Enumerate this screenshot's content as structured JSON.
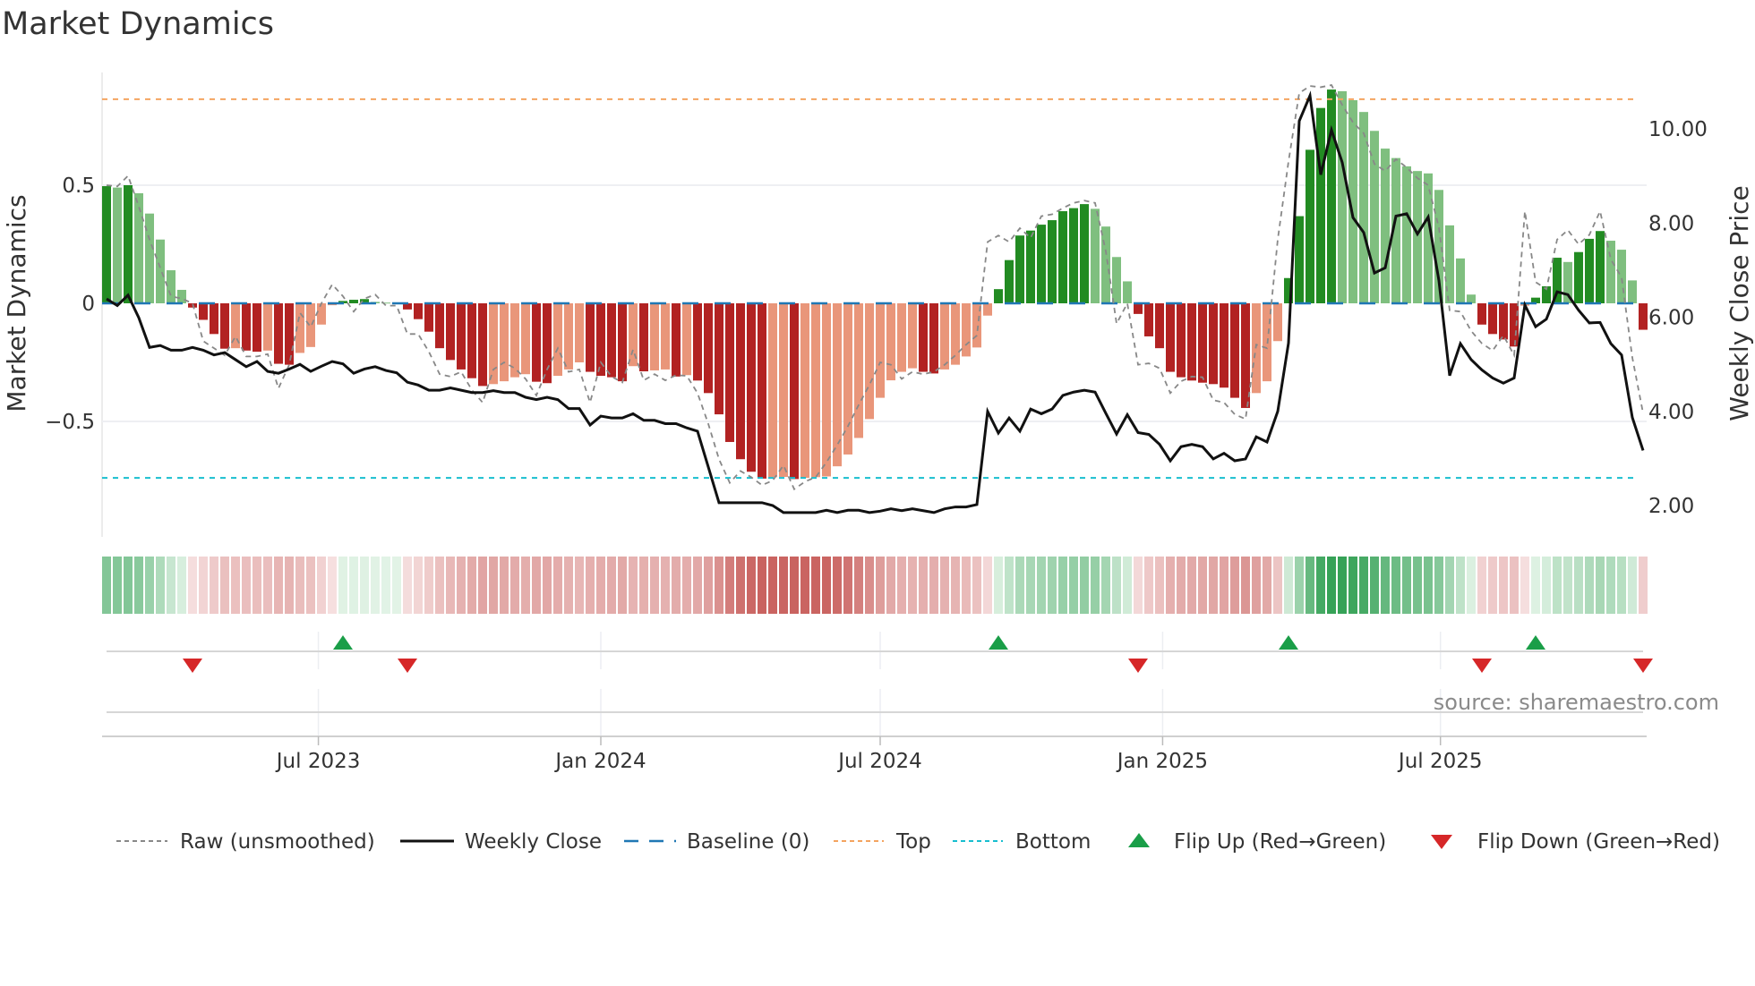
{
  "title": "Market Dynamics",
  "source": "source: sharemaestro.com",
  "colors": {
    "rising_positive": "#228b22",
    "falling_positive": "#7fbf7f",
    "falling_negative": "#b22222",
    "rising_negative": "#e9967a",
    "raw": "#888888",
    "close": "#111111",
    "baseline": "#1f77b4",
    "top": "#f4a460",
    "bottom": "#17becf",
    "flip_up": "#1a9e48",
    "flip_down": "#d62728"
  },
  "legend": {
    "raw": "Raw (unsmoothed)",
    "close": "Weekly Close",
    "baseline": "Baseline (0)",
    "top": "Top",
    "bottom": "Bottom",
    "flip_up": "Flip Up (Red→Green)",
    "flip_down": "Flip Down (Green→Red)"
  },
  "chart_data": {
    "type": "bar",
    "title": "Market Dynamics",
    "ylabel": "Market Dynamics",
    "y2label": "Weekly Close Price",
    "ylim": [
      -0.98,
      0.98
    ],
    "y2lim": [
      1.2,
      11.4
    ],
    "yticks": [
      {
        "v": 0.5,
        "label": "0.5"
      },
      {
        "v": 0,
        "label": "0"
      },
      {
        "v": -0.5,
        "label": "−0.5"
      }
    ],
    "y2ticks": [
      {
        "v": 10,
        "label": "10.00"
      },
      {
        "v": 8,
        "label": "8.00"
      },
      {
        "v": 6,
        "label": "6.00"
      },
      {
        "v": 4,
        "label": "4.00"
      },
      {
        "v": 2,
        "label": "2.00"
      }
    ],
    "xticks": [
      {
        "date": "2023-07-01",
        "label": "Jul 2023"
      },
      {
        "date": "2024-01-01",
        "label": "Jan 2024"
      },
      {
        "date": "2024-07-01",
        "label": "Jul 2024"
      },
      {
        "date": "2025-01-01",
        "label": "Jan 2025"
      },
      {
        "date": "2025-07-01",
        "label": "Jul 2025"
      }
    ],
    "start_date": "2023-02-13",
    "frequency": "weekly",
    "top_level": 0.864,
    "bottom_level": -0.739,
    "baseline": 0,
    "dynamics": [
      0.496,
      0.49,
      0.5,
      0.466,
      0.38,
      0.27,
      0.14,
      0.057,
      -0.018,
      -0.07,
      -0.13,
      -0.192,
      -0.19,
      -0.2,
      -0.205,
      -0.2,
      -0.256,
      -0.26,
      -0.21,
      -0.185,
      -0.09,
      -0.008,
      0.01,
      0.015,
      0.018,
      0.006,
      0.003,
      0.002,
      -0.026,
      -0.067,
      -0.12,
      -0.19,
      -0.24,
      -0.28,
      -0.317,
      -0.35,
      -0.342,
      -0.33,
      -0.313,
      -0.3,
      -0.332,
      -0.338,
      -0.307,
      -0.28,
      -0.25,
      -0.29,
      -0.307,
      -0.313,
      -0.33,
      -0.266,
      -0.288,
      -0.284,
      -0.28,
      -0.31,
      -0.304,
      -0.327,
      -0.38,
      -0.47,
      -0.587,
      -0.66,
      -0.713,
      -0.742,
      -0.736,
      -0.735,
      -0.744,
      -0.739,
      -0.736,
      -0.733,
      -0.69,
      -0.64,
      -0.57,
      -0.49,
      -0.4,
      -0.326,
      -0.29,
      -0.275,
      -0.29,
      -0.297,
      -0.28,
      -0.26,
      -0.225,
      -0.187,
      -0.052,
      0.06,
      0.183,
      0.287,
      0.308,
      0.333,
      0.352,
      0.39,
      0.403,
      0.42,
      0.4,
      0.325,
      0.196,
      0.093,
      -0.045,
      -0.14,
      -0.19,
      -0.29,
      -0.313,
      -0.327,
      -0.336,
      -0.342,
      -0.357,
      -0.4,
      -0.443,
      -0.38,
      -0.33,
      -0.16,
      0.107,
      0.369,
      0.65,
      0.827,
      0.905,
      0.898,
      0.86,
      0.81,
      0.73,
      0.655,
      0.615,
      0.58,
      0.56,
      0.55,
      0.48,
      0.33,
      0.19,
      0.037,
      -0.09,
      -0.13,
      -0.153,
      -0.183,
      -0.01,
      0.024,
      0.072,
      0.193,
      0.175,
      0.217,
      0.273,
      0.306,
      0.265,
      0.227,
      0.097,
      -0.112
    ],
    "raw": [
      0.5,
      0.495,
      0.54,
      0.41,
      0.27,
      0.15,
      0.03,
      0.02,
      0.0,
      -0.16,
      -0.19,
      -0.22,
      -0.14,
      -0.225,
      -0.225,
      -0.215,
      -0.36,
      -0.26,
      -0.04,
      -0.1,
      0.0,
      0.08,
      0.03,
      -0.035,
      0.02,
      0.037,
      -0.01,
      -0.01,
      -0.13,
      -0.13,
      -0.205,
      -0.3,
      -0.31,
      -0.29,
      -0.367,
      -0.42,
      -0.28,
      -0.25,
      -0.275,
      -0.32,
      -0.39,
      -0.28,
      -0.19,
      -0.29,
      -0.28,
      -0.42,
      -0.25,
      -0.31,
      -0.335,
      -0.196,
      -0.326,
      -0.3,
      -0.326,
      -0.304,
      -0.307,
      -0.38,
      -0.51,
      -0.66,
      -0.76,
      -0.71,
      -0.736,
      -0.77,
      -0.75,
      -0.686,
      -0.787,
      -0.755,
      -0.736,
      -0.673,
      -0.6,
      -0.52,
      -0.43,
      -0.345,
      -0.25,
      -0.26,
      -0.32,
      -0.29,
      -0.3,
      -0.29,
      -0.26,
      -0.22,
      -0.175,
      -0.136,
      0.26,
      0.287,
      0.26,
      0.318,
      0.277,
      0.369,
      0.377,
      0.403,
      0.425,
      0.435,
      0.425,
      0.22,
      -0.086,
      0.0,
      -0.26,
      -0.254,
      -0.275,
      -0.38,
      -0.33,
      -0.31,
      -0.313,
      -0.41,
      -0.42,
      -0.47,
      -0.49,
      -0.175,
      -0.19,
      0.27,
      0.6,
      0.89,
      0.92,
      0.915,
      0.924,
      0.84,
      0.766,
      0.72,
      0.59,
      0.56,
      0.61,
      0.575,
      0.53,
      0.5,
      0.32,
      -0.03,
      -0.035,
      -0.117,
      -0.17,
      -0.2,
      -0.136,
      -0.22,
      0.39,
      0.09,
      0.06,
      0.27,
      0.31,
      0.25,
      0.29,
      0.39,
      0.186,
      0.11,
      -0.23,
      -0.465
    ],
    "close": [
      6.39,
      6.25,
      6.47,
      5.99,
      5.36,
      5.4,
      5.3,
      5.3,
      5.36,
      5.3,
      5.2,
      5.25,
      5.1,
      4.95,
      5.06,
      4.85,
      4.81,
      4.9,
      5.0,
      4.85,
      4.96,
      5.06,
      5.01,
      4.81,
      4.9,
      4.95,
      4.87,
      4.82,
      4.62,
      4.56,
      4.45,
      4.45,
      4.5,
      4.45,
      4.4,
      4.4,
      4.44,
      4.4,
      4.4,
      4.3,
      4.25,
      4.3,
      4.25,
      4.06,
      4.06,
      3.71,
      3.9,
      3.86,
      3.86,
      3.95,
      3.81,
      3.81,
      3.74,
      3.74,
      3.65,
      3.58,
      2.82,
      2.06,
      2.06,
      2.06,
      2.06,
      2.06,
      2.0,
      1.85,
      1.85,
      1.85,
      1.85,
      1.9,
      1.85,
      1.9,
      1.9,
      1.85,
      1.88,
      1.93,
      1.89,
      1.93,
      1.89,
      1.85,
      1.93,
      1.97,
      1.97,
      2.02,
      4.0,
      3.54,
      3.86,
      3.58,
      4.05,
      3.95,
      4.05,
      4.34,
      4.41,
      4.45,
      4.41,
      3.96,
      3.52,
      3.93,
      3.55,
      3.51,
      3.3,
      2.95,
      3.25,
      3.3,
      3.25,
      2.99,
      3.11,
      2.95,
      2.99,
      3.46,
      3.35,
      4.0,
      5.45,
      10.17,
      10.71,
      9.03,
      9.98,
      9.29,
      8.12,
      7.8,
      6.94,
      7.05,
      8.15,
      8.2,
      7.77,
      8.13,
      6.78,
      4.76,
      5.44,
      5.1,
      4.88,
      4.71,
      4.6,
      4.71,
      6.26,
      5.8,
      5.96,
      6.54,
      6.48,
      6.15,
      5.88,
      5.89,
      5.44,
      5.2,
      3.87,
      3.17
    ]
  }
}
